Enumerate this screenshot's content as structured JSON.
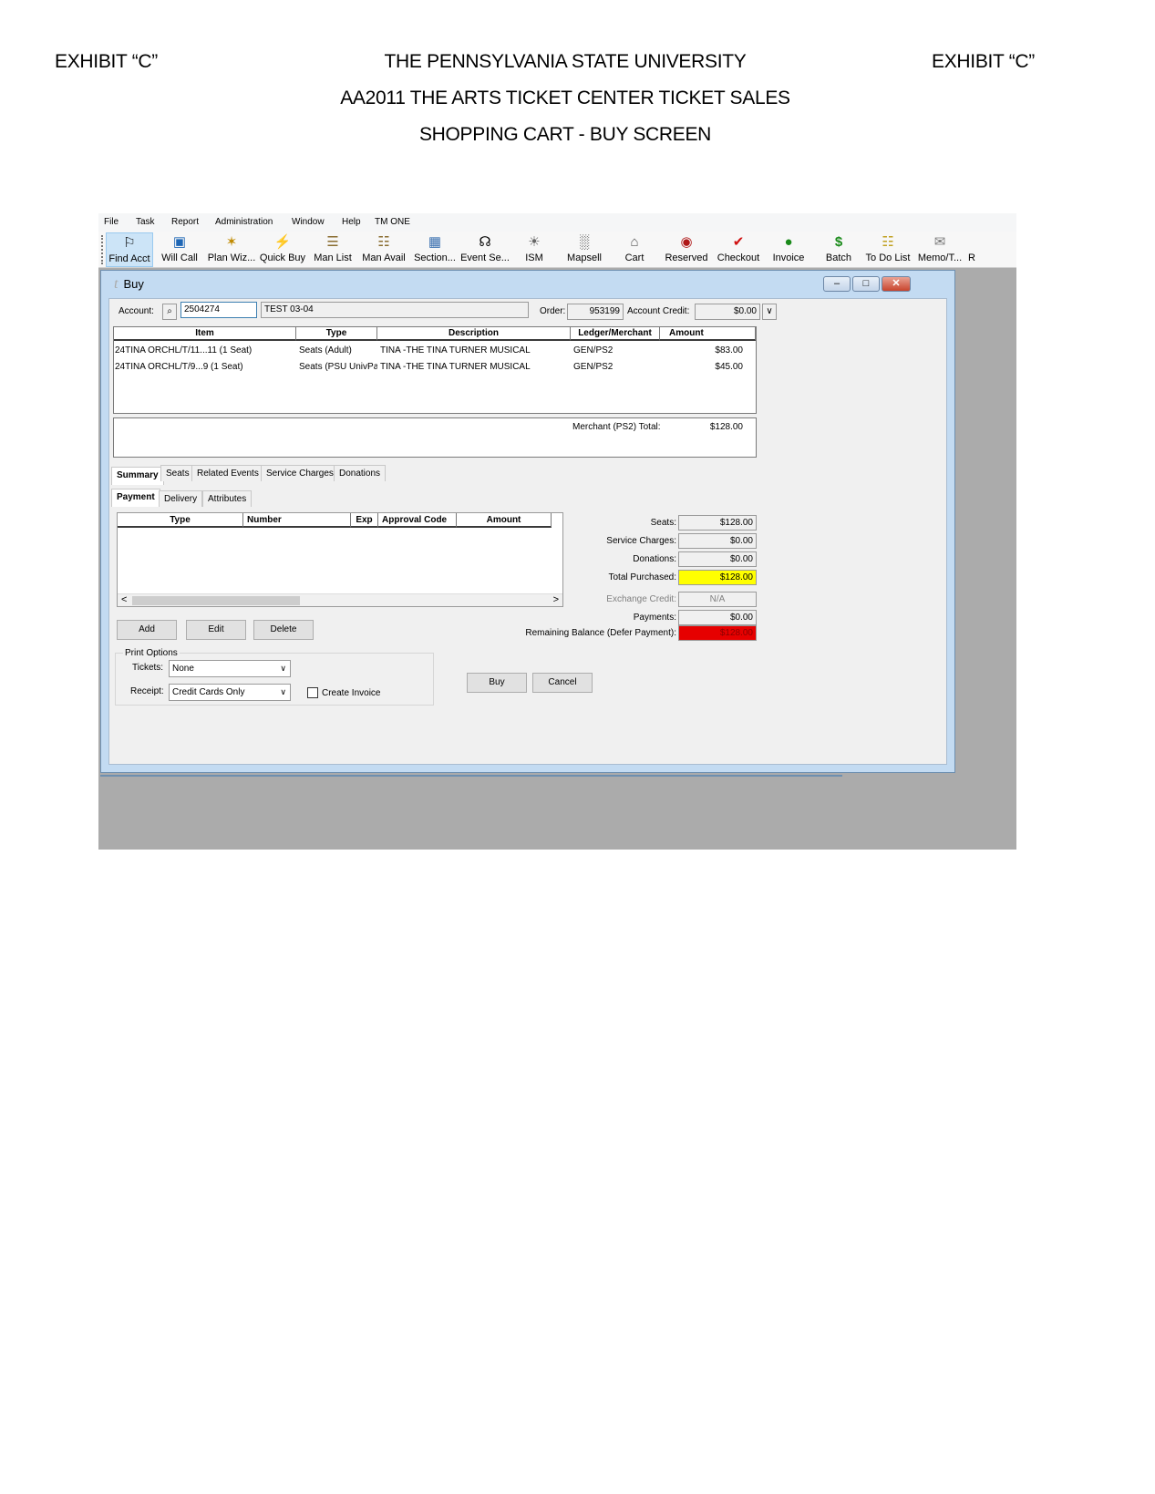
{
  "header": {
    "left": "EXHIBIT “C”",
    "right": "EXHIBIT “C”",
    "line1": "THE PENNSYLVANIA STATE UNIVERSITY",
    "line2": "AA2011 THE ARTS TICKET CENTER TICKET SALES",
    "line3": "SHOPPING CART - BUY SCREEN"
  },
  "menu": [
    "File",
    "Task",
    "Report",
    "Administration",
    "Window",
    "Help",
    "TM ONE"
  ],
  "toolbar": [
    {
      "label": "Find Acct",
      "icon": "find-account-icon",
      "glyph": "⚐"
    },
    {
      "label": "Will Call",
      "icon": "will-call-icon",
      "glyph": "▣"
    },
    {
      "label": "Plan Wiz...",
      "icon": "plan-wizard-icon",
      "glyph": "✶"
    },
    {
      "label": "Quick Buy",
      "icon": "lightning-icon",
      "glyph": "⚡"
    },
    {
      "label": "Man List",
      "icon": "scroll-list-icon",
      "glyph": "☰"
    },
    {
      "label": "Man Avail",
      "icon": "scroll-avail-icon",
      "glyph": "☷"
    },
    {
      "label": "Section...",
      "icon": "section-grid-icon",
      "glyph": "▦"
    },
    {
      "label": "Event Se...",
      "icon": "event-search-icon",
      "glyph": "☊"
    },
    {
      "label": "ISM",
      "icon": "ism-icon",
      "glyph": "☀"
    },
    {
      "label": "Mapsell",
      "icon": "mapsell-icon",
      "glyph": "░"
    },
    {
      "label": "Cart",
      "icon": "cart-icon",
      "glyph": "⌂"
    },
    {
      "label": "Reserved",
      "icon": "reserved-icon",
      "glyph": "◉"
    },
    {
      "label": "Checkout",
      "icon": "checkmark-icon",
      "glyph": "✔"
    },
    {
      "label": "Invoice",
      "icon": "money-bag-icon",
      "glyph": "●"
    },
    {
      "label": "Batch",
      "icon": "dollar-icon",
      "glyph": "$"
    },
    {
      "label": "To Do List",
      "icon": "todo-list-icon",
      "glyph": "☷"
    },
    {
      "label": "Memo/T...",
      "icon": "memo-icon",
      "glyph": "✉"
    },
    {
      "label": "R",
      "icon": "more-icon",
      "glyph": ""
    }
  ],
  "window": {
    "title": "Buy",
    "min": "–",
    "max": "□",
    "close": "✕"
  },
  "account": {
    "label": "Account:",
    "number": "2504274",
    "name": "TEST 03-04",
    "order_label": "Order:",
    "order": "953199",
    "credit_label": "Account Credit:",
    "credit": "$0.00"
  },
  "items": {
    "columns": [
      "Item",
      "Type",
      "Description",
      "Ledger/Merchant",
      "Amount"
    ],
    "rows": [
      {
        "item": "24TINA ORCHL/T/11...11 (1 Seat)",
        "type": "Seats (Adult)",
        "desc": "TINA -THE TINA TURNER MUSICAL",
        "ledger": "GEN/PS2",
        "amount": "$83.00"
      },
      {
        "item": "24TINA ORCHL/T/9...9 (1 Seat)",
        "type": "Seats (PSU UnivPar",
        "desc": "TINA -THE TINA TURNER MUSICAL",
        "ledger": "GEN/PS2",
        "amount": "$45.00"
      }
    ],
    "merchant_total_label": "Merchant (PS2) Total:",
    "merchant_total": "$128.00"
  },
  "tabs": [
    "Summary",
    "Seats",
    "Related Events",
    "Service Charges",
    "Donations"
  ],
  "subtabs": [
    "Payment",
    "Delivery",
    "Attributes"
  ],
  "payment": {
    "columns": [
      "Type",
      "Number",
      "Exp",
      "Approval Code",
      "Amount"
    ],
    "add": "Add",
    "edit": "Edit",
    "delete": "Delete",
    "scroll_left": "<",
    "scroll_right": ">"
  },
  "summary": {
    "seats_label": "Seats:",
    "seats": "$128.00",
    "service_label": "Service Charges:",
    "service": "$0.00",
    "donations_label": "Donations:",
    "donations": "$0.00",
    "total_label": "Total Purchased:",
    "total": "$128.00",
    "exchange_label": "Exchange Credit:",
    "exchange": "N/A",
    "payments_label": "Payments:",
    "payments": "$0.00",
    "remaining_label": "Remaining Balance (Defer Payment):",
    "remaining": "$128.00",
    "total_color": "#ffff00",
    "remaining_color": "#e60000"
  },
  "print": {
    "title": "Print Options",
    "tickets_label": "Tickets:",
    "tickets": "None",
    "receipt_label": "Receipt:",
    "receipt": "Credit Cards Only",
    "create_invoice": "Create Invoice",
    "create_invoice_checked": false
  },
  "actions": {
    "buy": "Buy",
    "cancel": "Cancel"
  }
}
